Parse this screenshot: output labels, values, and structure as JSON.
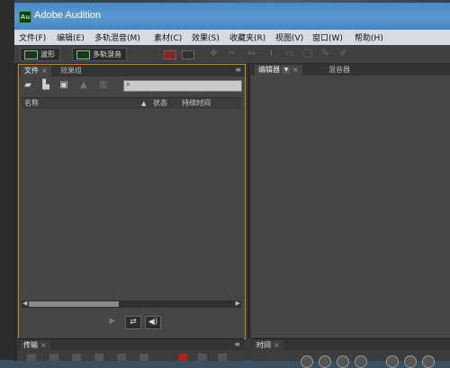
{
  "window": {
    "title": "Adobe Audition",
    "app_icon_text": "Au"
  },
  "menu": [
    "文件(F)",
    "编辑(E)",
    "多轨混音(M)",
    "素材(C)",
    "效果(S)",
    "收藏夹(R)",
    "视图(V)",
    "窗口(W)",
    "帮助(H)"
  ],
  "toolbar": {
    "waveform_label": "波形",
    "multitrack_label": "多轨混音"
  },
  "files_panel": {
    "tabs": [
      "文件",
      "效果组"
    ],
    "menu_icon": "≡",
    "search": {
      "value": "",
      "placeholder": ""
    },
    "columns": {
      "name": "名称",
      "status": "状态",
      "duration": "持续时间"
    }
  },
  "editor_panel": {
    "tabs": [
      "编辑器",
      "混音器"
    ]
  },
  "transport_panel": {
    "tab": "传输"
  },
  "time_panel": {
    "tab": "时间"
  },
  "colors": {
    "accent_border": "#b88a2b",
    "titlebar": "#4a88c4",
    "app_icon": "#3fa040"
  }
}
